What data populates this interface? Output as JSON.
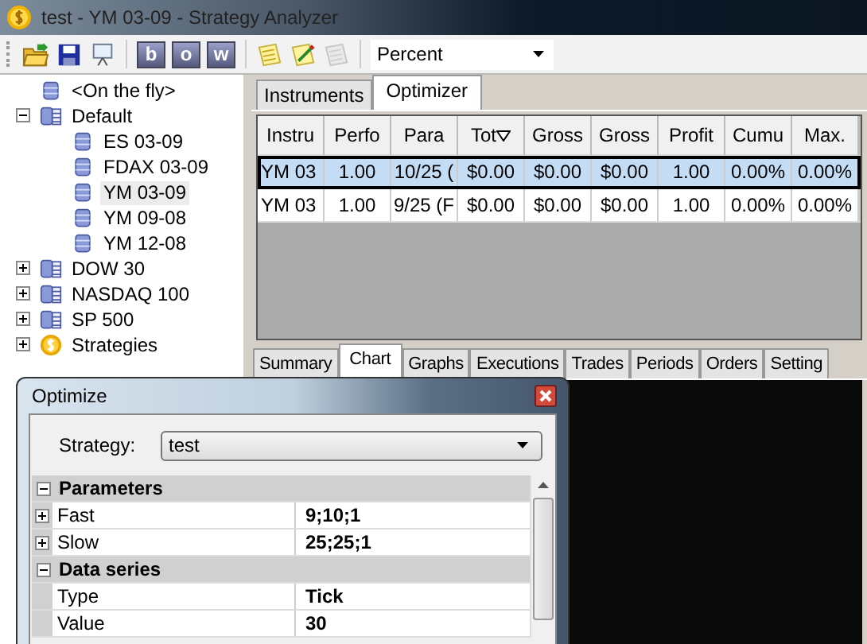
{
  "window": {
    "title": "test - YM 03-09 - Strategy Analyzer"
  },
  "toolbar": {
    "letter_buttons": [
      "b",
      "o",
      "w"
    ],
    "dropdown": {
      "value": "Percent"
    }
  },
  "tree": [
    {
      "label": "<On the fly>",
      "kind": "database",
      "selected": false
    },
    {
      "label": "Default",
      "kind": "folder",
      "expanded": true,
      "selected": false,
      "children": [
        {
          "label": "ES 03-09",
          "selected": false
        },
        {
          "label": "FDAX 03-09",
          "selected": false
        },
        {
          "label": "YM 03-09",
          "selected": true
        },
        {
          "label": "YM 09-08",
          "selected": false
        },
        {
          "label": "YM 12-08",
          "selected": false
        }
      ]
    },
    {
      "label": "DOW 30",
      "kind": "folder",
      "expanded": false,
      "selected": false
    },
    {
      "label": "NASDAQ 100",
      "kind": "folder",
      "expanded": false,
      "selected": false
    },
    {
      "label": "SP 500",
      "kind": "folder",
      "expanded": false,
      "selected": false
    },
    {
      "label": "Strategies",
      "kind": "strategy",
      "expanded": false,
      "selected": false
    }
  ],
  "top_tabs": [
    {
      "label": "Instruments",
      "selected": false
    },
    {
      "label": "Optimizer",
      "selected": true
    }
  ],
  "table": {
    "columns": [
      "Instru",
      "Perfo",
      "Para",
      "Tot",
      "Gross",
      "Gross",
      "Profit",
      "Cumu",
      "Max."
    ],
    "rows": [
      {
        "selected": true,
        "cells": [
          "YM 03",
          "1.00",
          "10/25 (",
          "$0.00",
          "$0.00",
          "$0.00",
          "1.00",
          "0.00%",
          "0.00%"
        ]
      },
      {
        "selected": false,
        "cells": [
          "YM 03",
          "1.00",
          "9/25 (F",
          "$0.00",
          "$0.00",
          "$0.00",
          "1.00",
          "0.00%",
          "0.00%"
        ]
      }
    ]
  },
  "bottom_tabs": [
    {
      "label": "Summary",
      "selected": false
    },
    {
      "label": "Chart",
      "selected": true
    },
    {
      "label": "Graphs",
      "selected": false
    },
    {
      "label": "Executions",
      "selected": false
    },
    {
      "label": "Trades",
      "selected": false
    },
    {
      "label": "Periods",
      "selected": false
    },
    {
      "label": "Orders",
      "selected": false
    },
    {
      "label": "Setting",
      "selected": false
    }
  ],
  "dialog": {
    "title": "Optimize",
    "strategy_label": "Strategy:",
    "strategy_value": "test",
    "properties": [
      {
        "kind": "category",
        "label": "Parameters",
        "expanded": true
      },
      {
        "kind": "property",
        "label": "Fast",
        "value": "9;10;1",
        "expandable": true
      },
      {
        "kind": "property",
        "label": "Slow",
        "value": "25;25;1",
        "expandable": true
      },
      {
        "kind": "category",
        "label": "Data series",
        "expanded": true
      },
      {
        "kind": "property",
        "label": "Type",
        "value": "Tick"
      },
      {
        "kind": "property",
        "label": "Value",
        "value": "30"
      }
    ]
  }
}
